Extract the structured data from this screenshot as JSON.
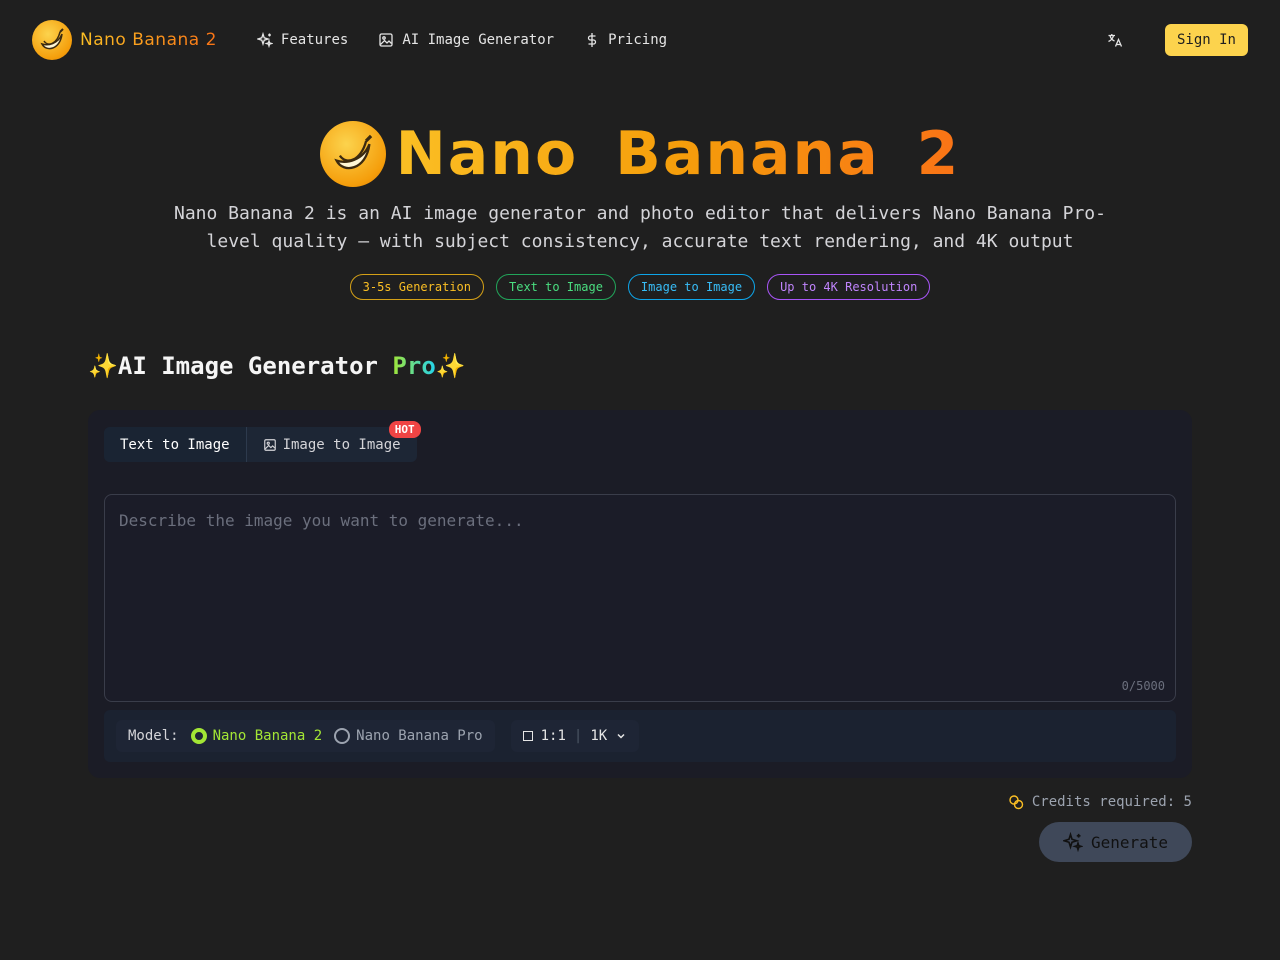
{
  "nav": {
    "brand": "Nano Banana 2",
    "links": [
      {
        "label": "Features",
        "icon": "sparkles-icon"
      },
      {
        "label": "AI Image Generator",
        "icon": "image-icon"
      },
      {
        "label": "Pricing",
        "icon": "dollar-icon"
      }
    ],
    "language_icon": "translate-icon",
    "sign_in": "Sign In"
  },
  "hero": {
    "title": "Nano Banana 2",
    "subtitle": "Nano Banana 2 is an AI image generator and photo editor that delivers Nano Banana Pro-level quality — with subject consistency, accurate text rendering, and 4K output",
    "badges": [
      "3-5s Generation",
      "Text to Image",
      "Image to Image",
      "Up to 4K Resolution"
    ]
  },
  "generator": {
    "title_prefix": "✨AI Image Generator ",
    "title_pro": "Pro",
    "title_suffix": "✨",
    "tabs": [
      "Text to Image",
      "Image to Image"
    ],
    "active_tab": "Text to Image",
    "hot_badge": "HOT",
    "prompt_placeholder": "Describe the image you want to generate...",
    "prompt_value": "",
    "char_count": "0/5000",
    "model_label": "Model:",
    "models": [
      "Nano Banana 2",
      "Nano Banana Pro"
    ],
    "selected_model": "Nano Banana 2",
    "aspect_ratio": "1:1",
    "resolution": "1K",
    "credits_text": "Credits required: 5",
    "generate_label": "Generate"
  },
  "colors": {
    "accent": "#fbbf24",
    "brand_gradient_end": "#f97316",
    "selected_model": "#a3e635",
    "hot": "#ef4444"
  }
}
